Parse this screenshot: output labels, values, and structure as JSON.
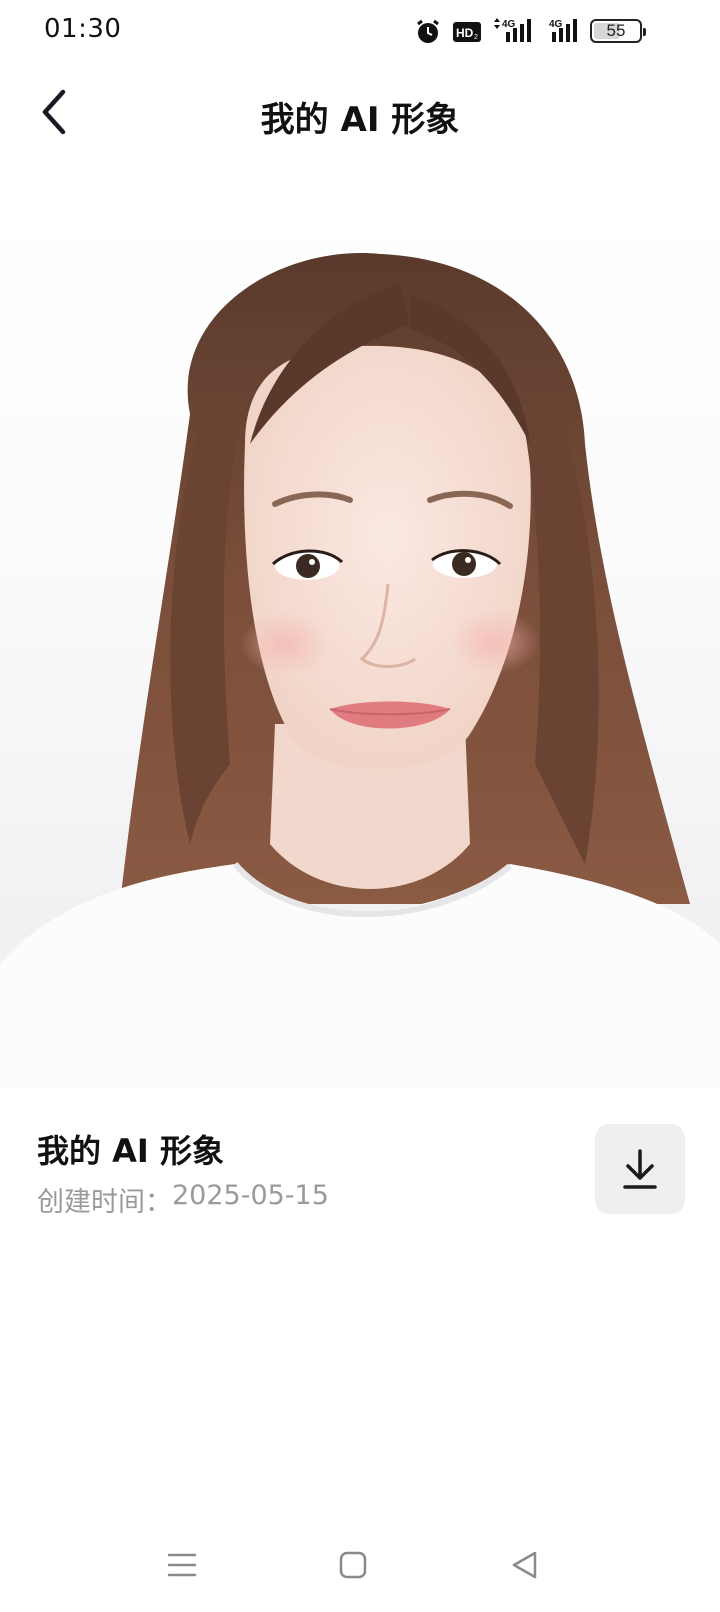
{
  "status_bar": {
    "time": "01:30",
    "icons": [
      "alarm-icon",
      "hd-icon",
      "signal-4g-icon",
      "signal-4g-icon"
    ],
    "network_labels": [
      "4G",
      "4G"
    ],
    "battery_level": "55"
  },
  "header": {
    "back_icon": "chevron-left-icon",
    "title": "我的 AI 形象"
  },
  "portrait": {
    "description_icon": "ai-portrait-image"
  },
  "info": {
    "title": "我的 AI 形象",
    "date_label": "创建时间：",
    "date_value": "2025-05-15",
    "download_icon": "download-icon"
  },
  "nav_bar": {
    "icons": [
      "menu-icon",
      "home-square-icon",
      "back-triangle-icon"
    ]
  },
  "colors": {
    "text_primary": "#111111",
    "text_secondary": "#9a9a9a",
    "button_bg": "#efefef",
    "hair": "#6b4433",
    "skin": "#f6ddd4",
    "lips": "#e07c80"
  }
}
